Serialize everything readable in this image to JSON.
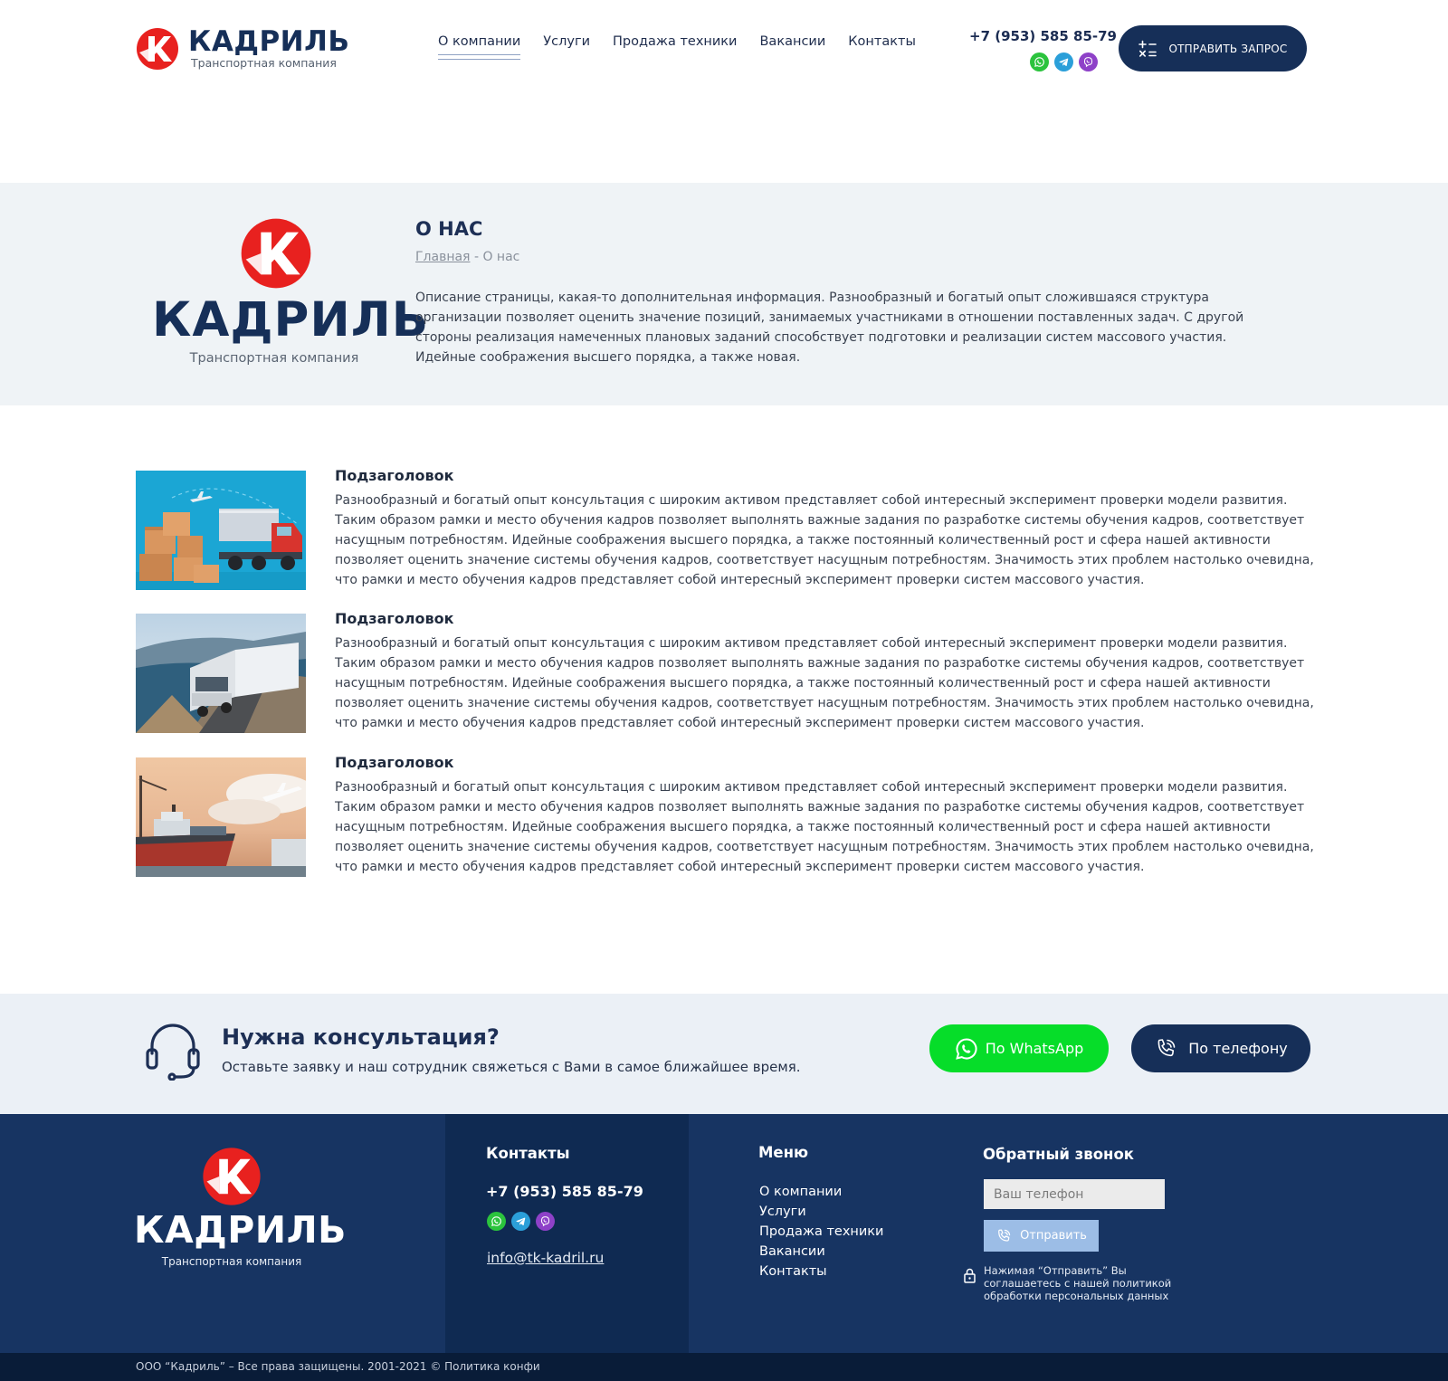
{
  "header": {
    "brand_name": "КАДРИЛЬ",
    "brand_sub": "Транспортная компания",
    "nav": [
      {
        "label": "О компании"
      },
      {
        "label": "Услуги"
      },
      {
        "label": "Продажа техники"
      },
      {
        "label": "Вакансии"
      },
      {
        "label": "Контакты"
      }
    ],
    "active_nav": "О компании",
    "phone": "+7 (953) 585 85-79",
    "messengers": [
      "whatsapp-icon",
      "telegram-icon",
      "viber-icon"
    ],
    "request_button": "ОТПРАВИТЬ ЗАПРОС"
  },
  "hero": {
    "brand_name": "КАДРИЛЬ",
    "brand_sub": "Транспортная компания",
    "title": "О НАС",
    "breadcrumb_home": "Главная",
    "breadcrumb_current": "- О нас",
    "description": "Описание страницы, какая-то дополнительная информация. Разнообразный и богатый опыт сложившаяся структура организации позволяет оценить значение позиций, занимаемых участниками в отношении поставленных задач. С другой стороны реализация намеченных плановых заданий способствует подготовки и реализации систем массового участия. Идейные соображения высшего порядка, а также новая."
  },
  "features": [
    {
      "title": "Подзаголовок",
      "text": "Разнообразный и богатый опыт консультация с широким активом представляет собой интересный эксперимент проверки модели развития. Таким образом рамки и место обучения кадров позволяет выполнять важные задания по разработке системы обучения кадров, соответствует насущным потребностям. Идейные соображения высшего порядка, а также постоянный количественный рост и сфера нашей активности позволяет оценить значение системы обучения кадров, соответствует насущным потребностям. Значимость этих проблем настолько очевидна, что рамки и место обучения кадров представляет собой интересный эксперимент проверки систем массового участия."
    },
    {
      "title": "Подзаголовок",
      "text": "Разнообразный и богатый опыт консультация с широким активом представляет собой интересный эксперимент проверки модели развития. Таким образом рамки и место обучения кадров позволяет выполнять важные задания по разработке системы обучения кадров, соответствует насущным потребностям. Идейные соображения высшего порядка, а также постоянный количественный рост и сфера нашей активности позволяет оценить значение системы обучения кадров, соответствует насущным потребностям. Значимость этих проблем настолько очевидна, что рамки и место обучения кадров представляет собой интересный эксперимент проверки систем массового участия."
    },
    {
      "title": "Подзаголовок",
      "text": "Разнообразный и богатый опыт консультация с широким активом представляет собой интересный эксперимент проверки модели развития. Таким образом рамки и место обучения кадров позволяет выполнять важные задания по разработке системы обучения кадров, соответствует насущным потребностям. Идейные соображения высшего порядка, а также постоянный количественный рост и сфера нашей активности позволяет оценить значение системы обучения кадров, соответствует насущным потребностям. Значимость этих проблем настолько очевидна, что рамки и место обучения кадров представляет собой интересный эксперимент проверки систем массового участия."
    }
  ],
  "consult": {
    "title": "Нужна консультация?",
    "subtitle": "Оставьте заявку и наш сотрудник свяжеться с Вами в самое ближайшее время.",
    "whatsapp_button": "По WhatsApp",
    "phone_button": "По телефону"
  },
  "footer": {
    "brand_name": "КАДРИЛЬ",
    "brand_sub": "Транспортная компания",
    "contacts_title": "Контакты",
    "phone": "+7 (953) 585 85-79",
    "email": "info@tk-kadril.ru",
    "menu_title": "Меню",
    "menu": [
      {
        "label": "О компании"
      },
      {
        "label": "Услуги"
      },
      {
        "label": "Продажа техники"
      },
      {
        "label": "Вакансии"
      },
      {
        "label": "Контакты"
      }
    ],
    "callback_title": "Обратный звонок",
    "phone_placeholder": "Ваш телефон",
    "send_button": "Отправить",
    "consent_note": "Нажимая “Отправить” Вы соглашаетесь с нашей политикой обработки персональных данных",
    "copyright": "ООО “Кадриль” – Все права защищены.  2001-2021 © Политика конфи"
  },
  "colors": {
    "brand_navy": "#162f58",
    "brand_red": "#e8211f",
    "whatsapp_green": "#06dd29",
    "hero_bg": "#eff3f6",
    "footer_bg": "#173462"
  }
}
